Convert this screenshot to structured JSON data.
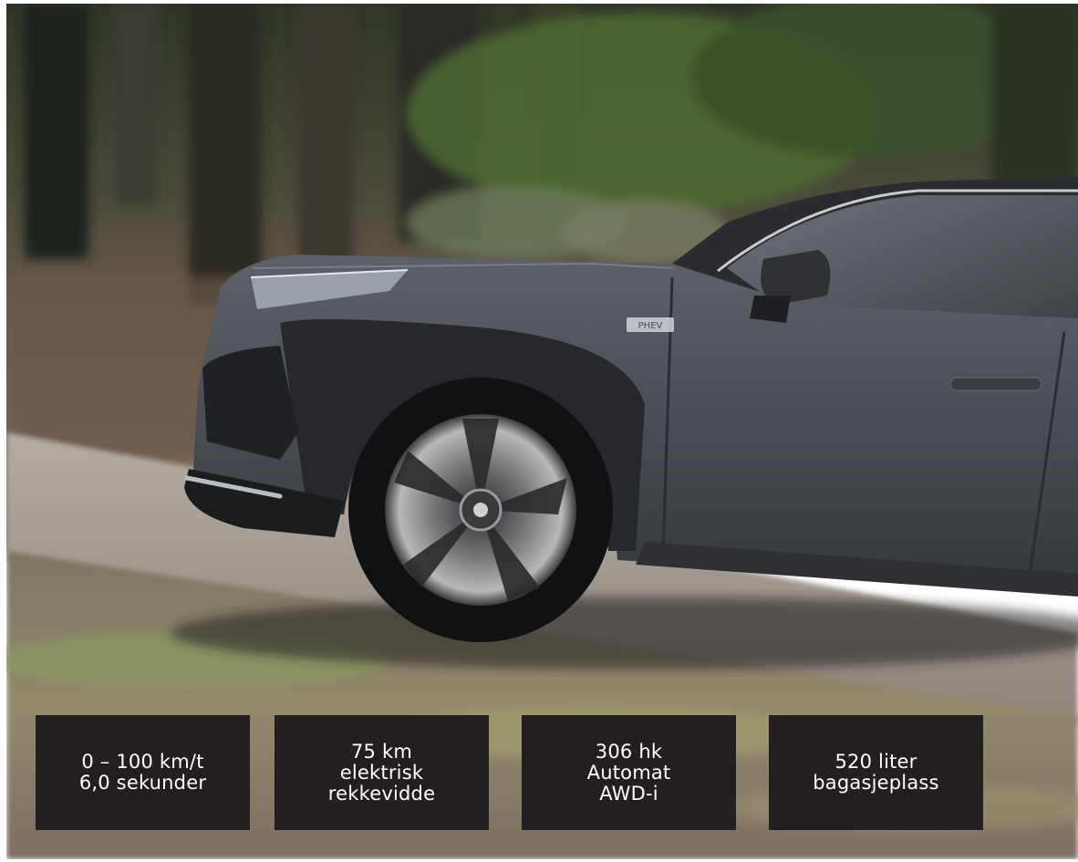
{
  "photo": {
    "subject": "dark-grey-suv-driving-on-forest-road",
    "badge_text": "PHEV"
  },
  "stats": [
    {
      "lines": [
        "0 – 100 km/t",
        "6,0 sekunder"
      ]
    },
    {
      "lines": [
        "75 km",
        "elektrisk",
        "rekkevidde"
      ]
    },
    {
      "lines": [
        "306 hk",
        "Automat",
        "AWD-i"
      ]
    },
    {
      "lines": [
        "520 liter",
        "bagasjeplass"
      ]
    }
  ],
  "colors": {
    "stat_box_bg": "#231f20",
    "stat_text": "#ffffff",
    "car_body": "#4a4e54"
  }
}
